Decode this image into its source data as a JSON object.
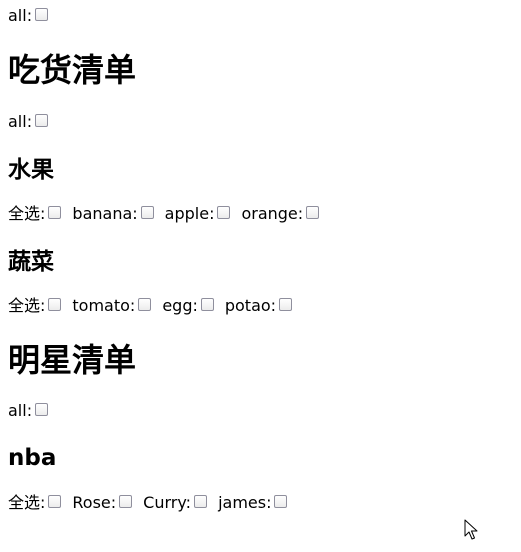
{
  "top": {
    "all_label": "all:"
  },
  "groups": [
    {
      "title": "吃货清单",
      "all_label": "all:",
      "sections": [
        {
          "title": "水果",
          "items": [
            "全选:",
            "banana:",
            "apple:",
            "orange:"
          ]
        },
        {
          "title": "蔬菜",
          "items": [
            "全选:",
            "tomato:",
            "egg:",
            "potao:"
          ]
        }
      ]
    },
    {
      "title": "明星清单",
      "all_label": "all:",
      "sections": [
        {
          "title": "nba",
          "items": [
            "全选:",
            "Rose:",
            "Curry:",
            "james:"
          ]
        }
      ]
    }
  ],
  "icons": {
    "cursor": "mouse-pointer-icon"
  }
}
